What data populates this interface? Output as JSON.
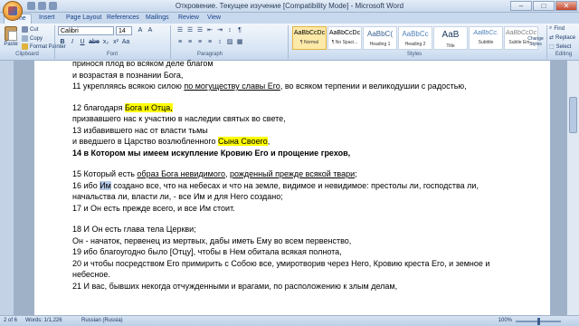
{
  "window": {
    "title": "Откровение. Текущее изучение [Compatibility Mode] - Microsoft Word",
    "controls": [
      "–",
      "□",
      "✕"
    ]
  },
  "tabs": [
    "Home",
    "Insert",
    "Page Layout",
    "References",
    "Mailings",
    "Review",
    "View"
  ],
  "ribbon": {
    "clipboard": {
      "paste": "Paste",
      "cut": "Cut",
      "copy": "Copy",
      "format_painter": "Format Painter",
      "label": "Clipboard"
    },
    "font": {
      "name": "Calibri",
      "size": "14",
      "label": "Font",
      "buttons": [
        "B",
        "I",
        "U",
        "abe",
        "x₂",
        "x²",
        "Aa",
        "A",
        "A"
      ]
    },
    "paragraph": {
      "label": "Paragraph"
    },
    "styles": {
      "label": "Styles",
      "items": [
        {
          "sample": "AaBbCcDc",
          "name": "¶ Normal"
        },
        {
          "sample": "AaBbCcDc",
          "name": "¶ No Spaci..."
        },
        {
          "sample": "AaBbC(",
          "name": "Heading 1"
        },
        {
          "sample": "AaBbCc",
          "name": "Heading 2"
        },
        {
          "sample": "AaB",
          "name": "Title"
        },
        {
          "sample": "AaBbCc.",
          "name": "Subtitle"
        },
        {
          "sample": "AaBbCcDc",
          "name": "Subtle Em..."
        }
      ],
      "change_styles": "Change Styles"
    },
    "editing": {
      "label": "Editing",
      "find": "Find",
      "replace": "Replace",
      "select": "Select"
    }
  },
  "document": {
    "lines": [
      [
        {
          "t": "принося плод во всяком деле благом"
        }
      ],
      [
        {
          "t": "и возрастая в познании Бога,"
        }
      ],
      [
        {
          "t": "11 укрепляясь всякою силою "
        },
        {
          "t": "по могуществу славы Его",
          "s": "u"
        },
        {
          "t": ", во всяком терпении и великодушии с радостью,"
        }
      ],
      [],
      [
        {
          "t": "12 благодаря "
        },
        {
          "t": "Бога и Отца,",
          "s": "hl"
        }
      ],
      [
        {
          "t": "призвавшего нас к участию в наследии святых во свете,"
        }
      ],
      [
        {
          "t": "13 избавившего  нас от власти тьмы"
        }
      ],
      [
        {
          "t": "и введшего в Царство возлюбленного "
        },
        {
          "t": "Сына Своего",
          "s": "hl"
        },
        {
          "t": ","
        }
      ],
      [
        {
          "t": "14 в Котором мы имеем искупление Кровию Его и прощение грехов,",
          "s": "b"
        }
      ],
      [],
      [
        {
          "t": "15 Который есть "
        },
        {
          "t": "образ Бога невидимого",
          "s": "u"
        },
        {
          "t": ",  "
        },
        {
          "t": "рожденный прежде всякой твари",
          "s": "u"
        },
        {
          "t": ";"
        }
      ],
      [
        {
          "t": "16 ибо "
        },
        {
          "t": "Им",
          "s": "sel"
        },
        {
          "t": " создано все, что на небесах и что на земле, видимое и невидимое:  престолы ли, господства ли,"
        }
      ],
      [
        {
          "t": "начальства ли, власти ли, - все Им и для Него создано;"
        }
      ],
      [
        {
          "t": "17 и Он есть прежде всего, и все Им стоит."
        }
      ],
      [],
      [
        {
          "t": "18 И Он есть глава тела Церкви;"
        }
      ],
      [
        {
          "t": "Он - начаток, первенец из мертвых, дабы иметь Ему во всем первенство,"
        }
      ],
      [
        {
          "t": "19 ибо благоугодно было [Отцу], чтобы в Нем обитала всякая полнота,"
        }
      ],
      [
        {
          "t": "20 и чтобы посредством Его примирить с Собою все, умиротворив через Него, Кровию креста Его, и земное и"
        }
      ],
      [
        {
          "t": "небесное."
        }
      ],
      [
        {
          "t": "21 И вас, бывших некогда отчужденными и врагами, по расположению к злым делам,"
        }
      ]
    ]
  },
  "status": {
    "page": "2 of 6",
    "words": "Words: 1/1,226",
    "language": "Russian (Russia)",
    "zoom": "100%"
  },
  "colors": {
    "highlight": "#ffff00",
    "ribbon": "#d8e5f4"
  }
}
